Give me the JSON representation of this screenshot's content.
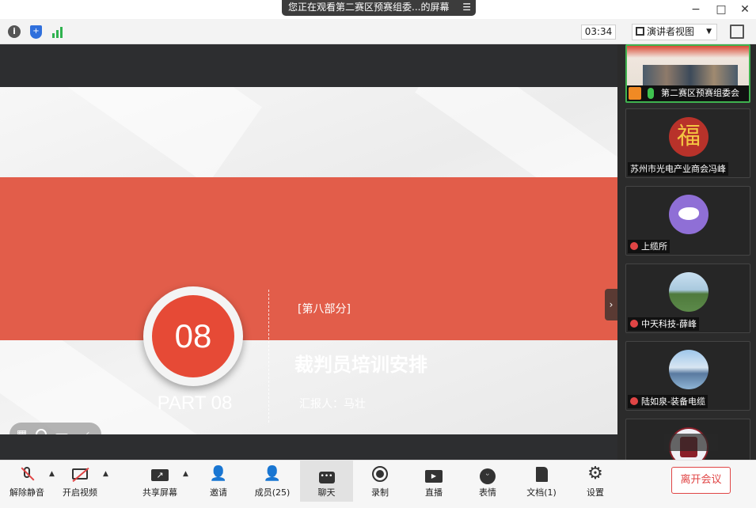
{
  "window": {
    "share_banner": "您正在观看第二赛区预赛组委...的屏幕",
    "minimize": "−",
    "maximize": "□",
    "close": "✕"
  },
  "toolbar": {
    "timer": "03:34",
    "view_mode": "演讲者视图",
    "colors": {
      "info": "#555555",
      "shield": "#2f6fdc",
      "signal": "#2fb24f"
    }
  },
  "slide": {
    "number": "08",
    "part_label": "PART 08",
    "section": "[第八部分]",
    "headline": "裁判员培训安排",
    "reporter": "汇报人：马壮",
    "colors": {
      "band": "#e25d4a",
      "circle": "#e64a36"
    }
  },
  "participants": [
    {
      "name": "第二赛区预赛组委会",
      "active": true,
      "avatar_color": "#c9a28a"
    },
    {
      "name": "苏州市光电产业商会冯峰",
      "active": false,
      "avatar_color": "#b8322a",
      "avatar_glyph": "福"
    },
    {
      "name": "上缆所",
      "active": false,
      "avatar_color": "#8f6fd6"
    },
    {
      "name": "中天科技-薛峰",
      "active": false,
      "avatar_color": "#5c8a5a"
    },
    {
      "name": "陆如泉-装备电缆",
      "active": false,
      "avatar_color": "#7aa8d8"
    },
    {
      "name": "",
      "active": false,
      "avatar_color": "#e8e8f0"
    }
  ],
  "bottom_bar": {
    "unmute": "解除静音",
    "start_video": "开启视频",
    "share_screen": "共享屏幕",
    "invite": "邀请",
    "members": "成员(25)",
    "chat": "聊天",
    "record": "录制",
    "live": "直播",
    "reactions": "表情",
    "docs": "文档(1)",
    "settings": "设置",
    "leave": "离开会议"
  }
}
